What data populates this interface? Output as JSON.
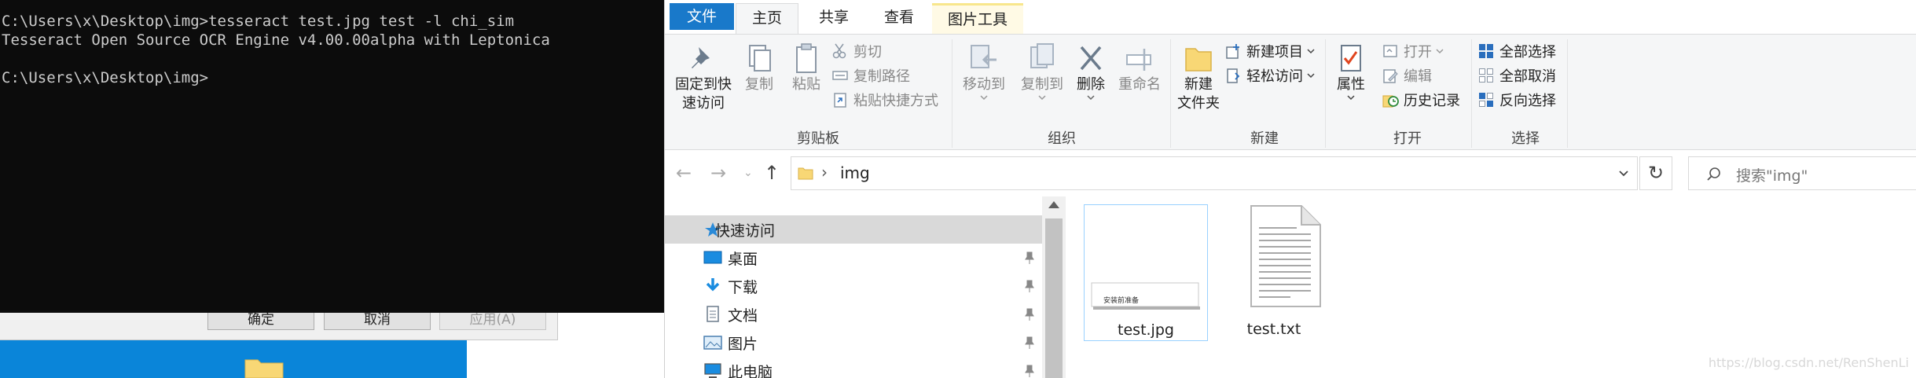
{
  "console": {
    "lines": [
      "C:\\Users\\x\\Desktop\\img>tesseract test.jpg test -l chi_sim",
      "Tesseract Open Source OCR Engine v4.00.00alpha with Leptonica",
      "",
      "C:\\Users\\x\\Desktop\\img>"
    ]
  },
  "background_dialog": {
    "ok_label": "确定",
    "cancel_label": "取消",
    "apply_label": "应用(A)"
  },
  "explorer": {
    "tabs": [
      "文件",
      "主页",
      "共享",
      "查看",
      "图片工具"
    ],
    "ribbon": {
      "clipboard": {
        "pin_label_1": "固定到快",
        "pin_label_2": "速访问",
        "copy": "复制",
        "paste": "粘贴",
        "cut": "剪切",
        "copy_path": "复制路径",
        "paste_shortcut": "粘贴快捷方式",
        "group": "剪贴板"
      },
      "organize": {
        "move_to": "移动到",
        "copy_to": "复制到",
        "delete": "删除",
        "rename": "重命名",
        "group": "组织"
      },
      "new": {
        "new_folder_1": "新建",
        "new_folder_2": "文件夹",
        "new_item": "新建项目",
        "easy_access": "轻松访问",
        "group": "新建"
      },
      "open": {
        "properties": "属性",
        "open": "打开",
        "edit": "编辑",
        "history": "历史记录",
        "group": "打开"
      },
      "select": {
        "select_all": "全部选择",
        "select_none": "全部取消",
        "invert": "反向选择",
        "group": "选择"
      }
    },
    "address": {
      "path": "img",
      "search_placeholder": "搜索\"img\""
    },
    "nav_items": [
      {
        "label": "快速访问",
        "icon": "star-icon",
        "pinned": false
      },
      {
        "label": "桌面",
        "icon": "desktop-icon",
        "pinned": true
      },
      {
        "label": "下载",
        "icon": "download-icon",
        "pinned": true
      },
      {
        "label": "文档",
        "icon": "document-icon",
        "pinned": true
      },
      {
        "label": "图片",
        "icon": "pictures-icon",
        "pinned": true
      },
      {
        "label": "此电脑",
        "icon": "computer-icon",
        "pinned": true
      }
    ],
    "files": [
      {
        "name": "test.jpg",
        "selected": true,
        "thumb_text": "安装前准备"
      },
      {
        "name": "test.txt",
        "selected": false
      }
    ],
    "watermark": "https://blog.csdn.net/RenShenLi"
  },
  "colors": {
    "console_bg": "#0c0c0c",
    "console_fg": "#cccccc",
    "file_tab": "#1979ca",
    "picture_tools_tab": "#fffae5",
    "accent_blue": "#0a85d9"
  }
}
